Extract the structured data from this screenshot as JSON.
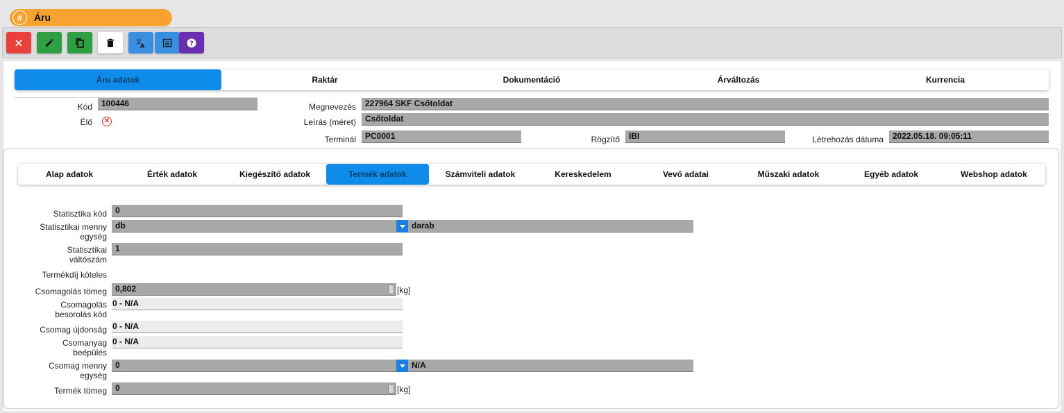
{
  "window": {
    "title": "Áru",
    "title_icon": "hash-icon"
  },
  "toolbar": {
    "buttons": [
      {
        "name": "close-button",
        "icon": "close-icon",
        "color": "#e8403a"
      },
      {
        "name": "edit-button",
        "icon": "pencil-icon",
        "color": "#2ea042"
      },
      {
        "name": "copy-button",
        "icon": "copy-icon",
        "color": "#2ea042"
      },
      {
        "name": "delete-button",
        "icon": "trash-icon",
        "color": "#ffffff"
      },
      {
        "name": "translate-button",
        "icon": "translate-icon",
        "color": "#3b8fe0"
      },
      {
        "name": "list-button",
        "icon": "list-icon",
        "color": "#3b8fe0"
      },
      {
        "name": "help-button",
        "icon": "help-icon",
        "color": "#6a2fb0"
      }
    ]
  },
  "top_tabs": [
    "Áru adatok",
    "Raktár",
    "Dokumentáció",
    "Árváltozás",
    "Kurrencia"
  ],
  "header_fields": {
    "kod_label": "Kód",
    "kod_value": "100446",
    "elo_label": "Élő",
    "megnevezes_label": "Megnevezés",
    "megnevezes_value": "227964 SKF Csőtoldat",
    "leiras_label": "Leírás (méret)",
    "leiras_value": "Csőtoldat",
    "terminal_label": "Terminál",
    "terminal_value": "PC0001",
    "rogzito_label": "Rögzítő",
    "rogzito_value": "IBI",
    "letrehozas_label": "Létrehozás dátuma",
    "letrehozas_value": "2022.05.18. 09:05:11"
  },
  "sub_tabs": [
    "Alap adatok",
    "Érték adatok",
    "Kiegészítő adatok",
    "Termék adatok",
    "Számviteli adatok",
    "Kereskedelem",
    "Vevő adatai",
    "Műszaki adatok",
    "Egyéb adatok",
    "Webshop adatok"
  ],
  "active_sub_tab": "Termék adatok",
  "form": {
    "statisztika_kod_label": "Statisztika kód",
    "statisztika_kod_value": "0",
    "stat_menny_label_1": "Statisztikai menny",
    "stat_menny_label_2": "egység",
    "stat_menny_value": "db",
    "stat_menny_desc": "darab",
    "stat_valtoszam_label_1": "Statisztikai",
    "stat_valtoszam_label_2": "váltószám",
    "stat_valtoszam_value": "1",
    "termekdij_label": "Termékdíj köteles",
    "csom_tomeg_label": "Csomagolás tömeg",
    "csom_tomeg_value": "0,802",
    "csom_tomeg_unit": "[kg]",
    "csom_besorolas_label_1": "Csomagolás",
    "csom_besorolas_label_2": "besorolás kód",
    "csom_besorolas_value": "0 - N/A",
    "csom_ujdonsag_label": "Csomag újdonság",
    "csom_ujdonsag_value": "0 - N/A",
    "csomanyag_label_1": "Csomanyag",
    "csomanyag_label_2": "beépülés",
    "csomanyag_value": "0 - N/A",
    "csom_menny_label_1": "Csomag menny",
    "csom_menny_label_2": "egység",
    "csom_menny_value": "0",
    "csom_menny_desc": "N/A",
    "termek_tomeg_label": "Termék tömeg",
    "termek_tomeg_value": "0",
    "termek_tomeg_unit": "[kg]"
  }
}
